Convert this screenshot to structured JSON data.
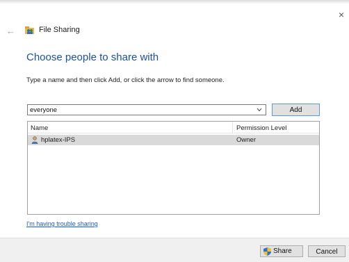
{
  "window": {
    "title": "File Sharing",
    "close_glyph": "×",
    "back_glyph": "←",
    "title_icon": "file-sharing-icon"
  },
  "main": {
    "heading": "Choose people to share with",
    "instruction": "Type a name and then click Add, or click the arrow to find someone.",
    "name_input": {
      "value": "everyone"
    },
    "add_label": "Add"
  },
  "list": {
    "columns": [
      "Name",
      "Permission Level"
    ],
    "rows": [
      {
        "name": "hplatex-IPS",
        "permission": "Owner",
        "icon": "user-icon"
      }
    ]
  },
  "links": {
    "trouble": "I'm having trouble sharing"
  },
  "footer": {
    "share_label": "Share",
    "cancel_label": "Cancel"
  },
  "colors": {
    "heading": "#1c4f9c",
    "link": "#1a5bbd",
    "selected_row": "#d9d9d9",
    "add_border": "#5b9bd5"
  }
}
